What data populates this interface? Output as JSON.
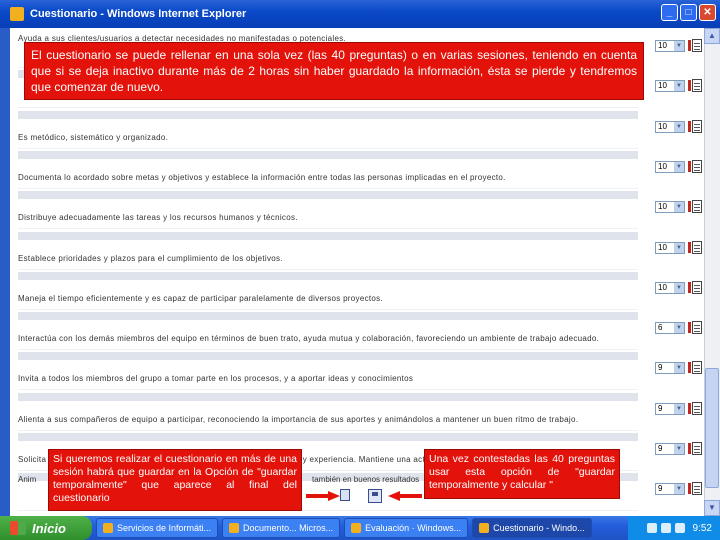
{
  "window": {
    "title": "Cuestionario - Windows Internet Explorer",
    "buttons": [
      "_",
      "□",
      "✕"
    ]
  },
  "questions": [
    {
      "text": "Ayuda a sus clientes/usuarios a detectar necesidades no manifestadas o potenciales.",
      "value": "10"
    },
    {
      "text": "",
      "value": "10"
    },
    {
      "text": "Es metódico, sistemático y organizado.",
      "value": "10"
    },
    {
      "text": "Documenta lo acordado sobre metas y objetivos y establece la información entre todas las personas implicadas en el proyecto.",
      "value": "10"
    },
    {
      "text": "Distribuye adecuadamente las tareas y los recursos humanos y técnicos.",
      "value": "10"
    },
    {
      "text": "Establece prioridades y plazos para el cumplimiento de los objetivos.",
      "value": "10"
    },
    {
      "text": "Maneja el tiempo eficientemente y es capaz de participar paralelamente de diversos proyectos.",
      "value": "10"
    },
    {
      "text": "Interactúa con los demás miembros del equipo en términos de buen trato, ayuda mutua y colaboración, favoreciendo un ambiente de trabajo adecuado.",
      "value": "6"
    },
    {
      "text": "Invita a todos los miembros del grupo a tomar parte en los procesos, y a aportar ideas y conocimientos",
      "value": "9"
    },
    {
      "text": "Alienta a sus compañeros de equipo a participar, reconociendo la importancia de sus aportes y animándolos a mantener un buen ritmo de trabajo.",
      "value": "9"
    },
    {
      "text": "Solicita la opinión de los demás miembros del grupo, valorando sus ideas y experiencia. Mantiene una actitud abierta a aprender de los otros.",
      "value": "9"
    },
    {
      "text": "",
      "value": "9"
    }
  ],
  "partial_row": {
    "left": "Anim",
    "right": "también en buenos resultados"
  },
  "callouts": {
    "top": "El cuestionario se puede rellenar en una sola vez (las 40 preguntas) o en varias sesiones, teniendo en cuenta que si se deja inactivo durante más de 2 horas sin haber guardado la información, ésta se pierde y tendremos que comenzar de nuevo.",
    "left": "Si queremos realizar el cuestionario en más de una sesión habrá que guardar en la Opción de \"guardar temporalmente\" que aparece al final del cuestionario",
    "right": "Una vez contestadas las 40 preguntas usar esta opción de \"guardar temporalmente y calcular \""
  },
  "taskbar": {
    "start_label": "Inicio",
    "tasks": [
      "Servicios de Informáti...",
      "Documento... Micros...",
      "Evaluación · Windows...",
      "Cuestionario - Windo..."
    ],
    "clock": "9:52"
  },
  "colors": {
    "callout": "#e3120b",
    "titlebar": "#0a49c9",
    "taskbar": "#245edb"
  }
}
